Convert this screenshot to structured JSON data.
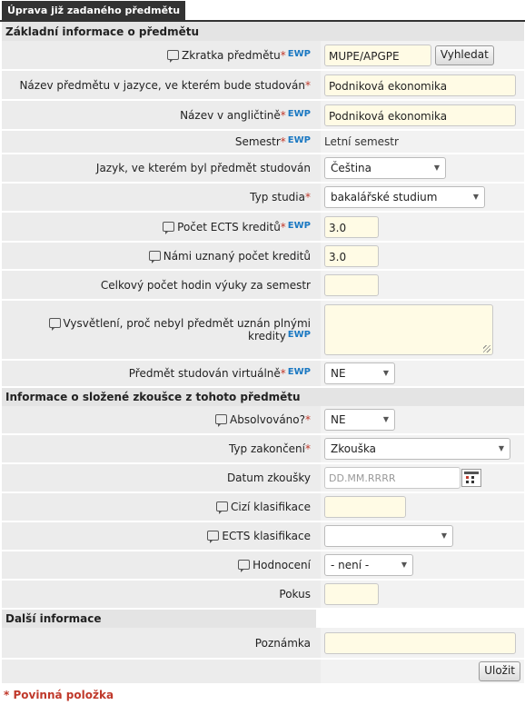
{
  "tab": "Úprava již zadaného předmětu",
  "ewp": "EWP",
  "req_mark": "*",
  "sections": {
    "basic": "Základní informace o předmětu",
    "exam": "Informace o složené zkoušce z tohoto předmětu",
    "other": "Další informace"
  },
  "fields": {
    "zkratka": {
      "label": "Zkratka předmětu",
      "value": "MUPE/APGPE"
    },
    "vyhledat": "Vyhledat",
    "nazev": {
      "label": "Název předmětu v jazyce, ve kterém bude studován",
      "value": "Podniková ekonomika"
    },
    "nazev_en": {
      "label": "Název v angličtině",
      "value": "Podniková ekonomika"
    },
    "semestr": {
      "label": "Semestr",
      "value": "Letní semestr"
    },
    "jazyk": {
      "label": "Jazyk, ve kterém byl předmět studován",
      "value": "Čeština"
    },
    "typ_studia": {
      "label": "Typ studia",
      "value": "bakalářské studium"
    },
    "ects": {
      "label": "Počet ECTS kreditů",
      "value": "3.0"
    },
    "uznany": {
      "label": "Námi uznaný počet kreditů",
      "value": "3.0"
    },
    "hodiny": {
      "label": "Celkový počet hodin výuky za semestr",
      "value": ""
    },
    "vysvetleni": {
      "label": "Vysvětlení, proč nebyl předmět uznán plnými kredity",
      "value": ""
    },
    "virtualne": {
      "label": "Předmět studován virtuálně",
      "value": "NE"
    },
    "absolvovano": {
      "label": "Absolvováno?",
      "value": "NE"
    },
    "typ_zakonceni": {
      "label": "Typ zakončení",
      "value": "Zkouška"
    },
    "datum": {
      "label": "Datum zkoušky",
      "placeholder": "DD.MM.RRRR"
    },
    "cizi": {
      "label": "Cizí klasifikace",
      "value": ""
    },
    "ects_klas": {
      "label": "ECTS klasifikace",
      "value": ""
    },
    "hodnoceni": {
      "label": "Hodnocení",
      "value": "- není -"
    },
    "pokus": {
      "label": "Pokus",
      "value": ""
    },
    "poznamka": {
      "label": "Poznámka",
      "value": ""
    }
  },
  "save": "Uložit",
  "footer": "* Povinná položka",
  "colors": {
    "required": "#c0392b",
    "ewp": "#1a78c2",
    "input_bg": "#fffbe5",
    "tab_bg": "#333333"
  }
}
